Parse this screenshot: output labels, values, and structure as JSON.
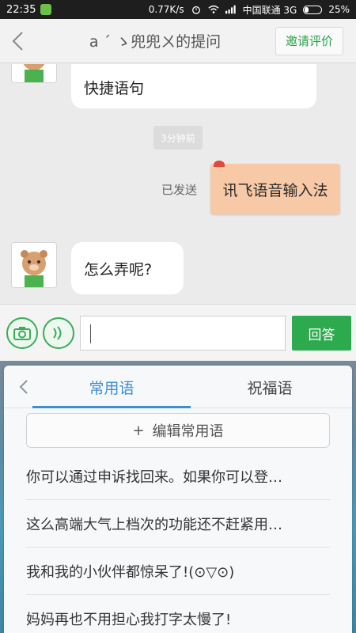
{
  "status_bar": {
    "time": "22:35",
    "speed": "0.77K/s",
    "carrier": "中国联通 3G",
    "battery": "25%",
    "battery_level": 0.25
  },
  "header": {
    "title": "a ´ ゝ兜兜ㄨ的提问",
    "invite_label": "邀请评价"
  },
  "chat": {
    "received_1": "快捷语句",
    "timestamp": "3分钟前",
    "sent_status": "已发送",
    "sent_message": "讯飞语音输入法",
    "received_2": "怎么弄呢?"
  },
  "input_bar": {
    "answer_label": "回答",
    "input_value": ""
  },
  "panel": {
    "tabs": [
      {
        "label": "常用语"
      },
      {
        "label": "祝福语"
      }
    ],
    "edit_label": "编辑常用语",
    "phrases": [
      "你可以通过申诉找回来。如果你可以登…",
      "这么高端大气上档次的功能还不赶紧用…",
      "我和我的小伙伴都惊呆了!(⊙▽⊙)",
      "妈妈再也不用担心我打字太慢了!"
    ]
  },
  "colors": {
    "accent_green": "#2daa4d",
    "tab_blue": "#3a8ed8",
    "sent_bubble": "#f7c9a6"
  }
}
